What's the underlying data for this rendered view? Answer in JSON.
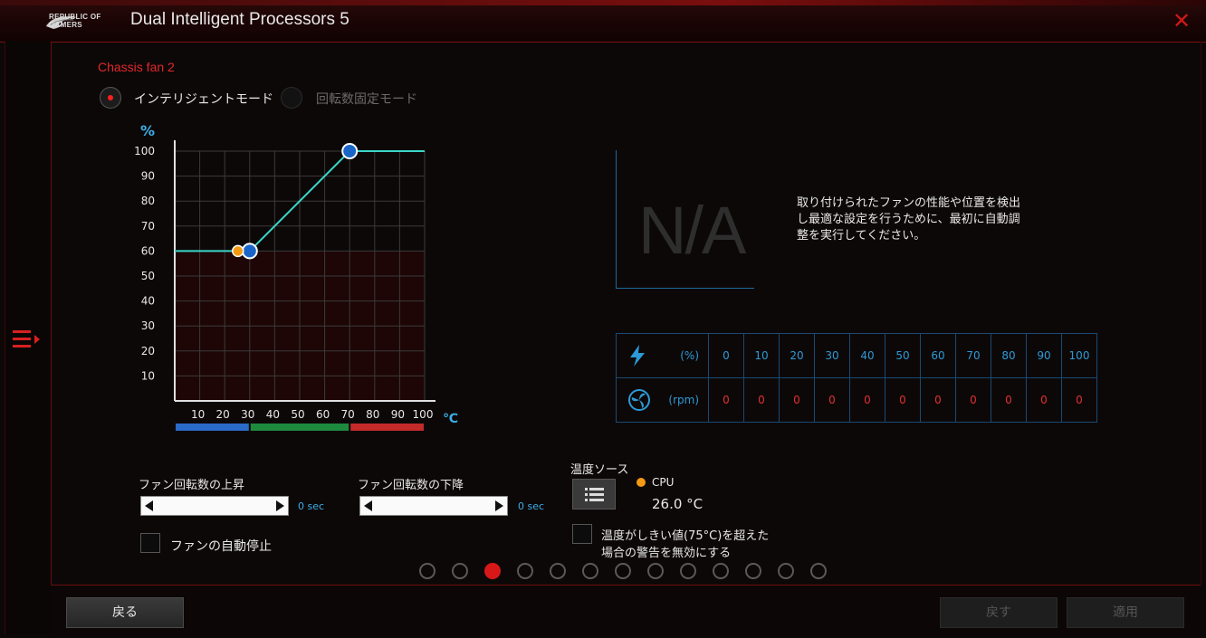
{
  "window": {
    "brand_line1": "REPUBLIC OF",
    "brand_line2": "GAMERS",
    "title": "Dual Intelligent Processors 5"
  },
  "fan": {
    "name": "Chassis fan 2",
    "mode_smart": "インテリジェントモード",
    "mode_fixed": "回転数固定モード",
    "selected_mode": "インテリジェントモード"
  },
  "graph": {
    "y_unit": "%",
    "x_unit": "℃",
    "y_ticks": [
      "100",
      "90",
      "80",
      "70",
      "60",
      "50",
      "40",
      "30",
      "20",
      "10"
    ],
    "x_ticks": [
      "10",
      "20",
      "30",
      "40",
      "50",
      "60",
      "70",
      "80",
      "90",
      "100"
    ],
    "curve_points": [
      {
        "temp": 25,
        "pct": 60
      },
      {
        "temp": 30,
        "pct": 60
      },
      {
        "temp": 70,
        "pct": 100
      }
    ],
    "current_point": {
      "temp": 26,
      "pct": 60
    },
    "zone_colors": [
      "#2a6bc8",
      "#1e8a3e",
      "#c42a2a"
    ],
    "curve_color": "#3ad6c8"
  },
  "calibration": {
    "na_text": "N/A",
    "message_lines": [
      "取り付けられたファンの性能や位置を検出",
      "し最適な設定を行うために、最初に自動調",
      "整を実行してください。"
    ]
  },
  "speed_table": {
    "pct_unit": "(%)",
    "rpm_unit": "(rpm)",
    "pct": [
      "0",
      "10",
      "20",
      "30",
      "40",
      "50",
      "60",
      "70",
      "80",
      "90",
      "100"
    ],
    "rpm": [
      "0",
      "0",
      "0",
      "0",
      "0",
      "0",
      "0",
      "0",
      "0",
      "0",
      "0"
    ]
  },
  "controls": {
    "spin_up_label": "ファン回転数の上昇",
    "spin_up_value": "0 sec",
    "spin_down_label": "ファン回転数の下降",
    "spin_down_value": "0 sec",
    "auto_stop_label": "ファンの自動停止",
    "temp_source_label": "温度ソース",
    "temp_source_name": "CPU",
    "temp_source_value": "26.0 °C",
    "warn_line1": "温度がしきい値(75°C)を超えた",
    "warn_line2": "場合の警告を無効にする"
  },
  "pager": {
    "count": 13,
    "active": 3
  },
  "footer": {
    "back_label": "戻る",
    "undo_label": "戻す",
    "apply_label": "適用"
  }
}
